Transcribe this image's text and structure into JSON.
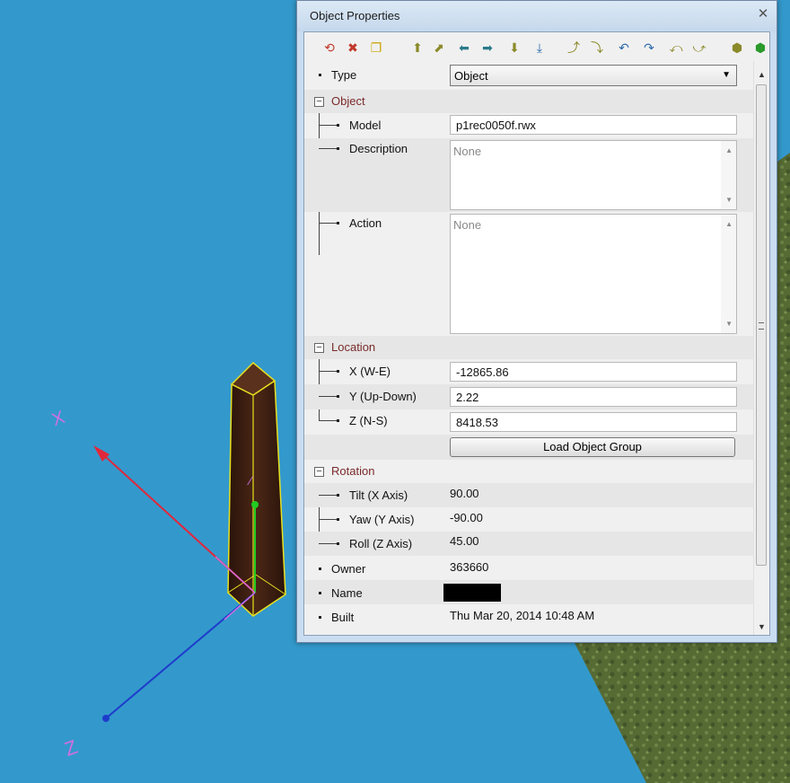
{
  "window": {
    "title": "Object Properties",
    "close_glyph": "✕"
  },
  "toolbar": [
    {
      "name": "rotate-icon",
      "glyph": "⟲",
      "color": "#c0392b"
    },
    {
      "name": "delete-icon",
      "glyph": "✖",
      "color": "#c0392b"
    },
    {
      "name": "duplicate-icon",
      "glyph": "❐",
      "color": "#c8a200"
    },
    {
      "name": "move-up-icon",
      "glyph": "⬆",
      "color": "#8a8a2a"
    },
    {
      "name": "move-north-icon",
      "glyph": "⬈",
      "color": "#8a8a2a"
    },
    {
      "name": "move-west-icon",
      "glyph": "⬅",
      "color": "#2a7a8a"
    },
    {
      "name": "move-east-icon",
      "glyph": "➡",
      "color": "#2a7a8a"
    },
    {
      "name": "move-down-icon",
      "glyph": "⬇",
      "color": "#8a8a2a"
    },
    {
      "name": "snap-ground-icon",
      "glyph": "⤓",
      "color": "#2a6aaa"
    },
    {
      "name": "tilt-icon",
      "glyph": "⤴",
      "color": "#8a8a2a"
    },
    {
      "name": "tilt-back-icon",
      "glyph": "⤵",
      "color": "#8a8a2a"
    },
    {
      "name": "yaw-left-icon",
      "glyph": "↶",
      "color": "#2a6aaa"
    },
    {
      "name": "yaw-right-icon",
      "glyph": "↷",
      "color": "#2a6aaa"
    },
    {
      "name": "roll-left-icon",
      "glyph": "⤺",
      "color": "#8a8a2a"
    },
    {
      "name": "roll-right-icon",
      "glyph": "⤻",
      "color": "#8a8a2a"
    },
    {
      "name": "select-icon",
      "glyph": "⬢",
      "color": "#8a8a2a"
    },
    {
      "name": "more-icon",
      "glyph": "⬢",
      "color": "#2a9a2a"
    }
  ],
  "type": {
    "label": "Type",
    "value": "Object"
  },
  "object": {
    "section": "Object",
    "model_label": "Model",
    "model_value": "p1rec0050f.rwx",
    "description_label": "Description",
    "description_value": "None",
    "action_label": "Action",
    "action_value": "None"
  },
  "location": {
    "section": "Location",
    "x_label": "X (W-E)",
    "x_value": "-12865.86",
    "y_label": "Y (Up-Down)",
    "y_value": "2.22",
    "z_label": "Z (N-S)",
    "z_value": "8418.53",
    "load_button": "Load Object Group"
  },
  "rotation": {
    "section": "Rotation",
    "tilt_label": "Tilt (X Axis)",
    "tilt_value": "90.00",
    "yaw_label": "Yaw (Y Axis)",
    "yaw_value": "-90.00",
    "roll_label": "Roll (Z Axis)",
    "roll_value": "45.00"
  },
  "owner": {
    "label": "Owner",
    "value": "363660"
  },
  "name": {
    "label": "Name"
  },
  "built": {
    "label": "Built",
    "value": "Thu Mar 20, 2014 10:48 AM"
  },
  "scene": {
    "axis_x_label": "X",
    "axis_z_label": "Z",
    "colors": {
      "sky": "#3399cc",
      "x_axis": "#e0283c",
      "z_axis": "#1e3ccc",
      "y_axis": "#22cc22",
      "gizmo_label": "#d070e0",
      "selection": "#e8e020",
      "pillar": "#3a1d10"
    }
  }
}
